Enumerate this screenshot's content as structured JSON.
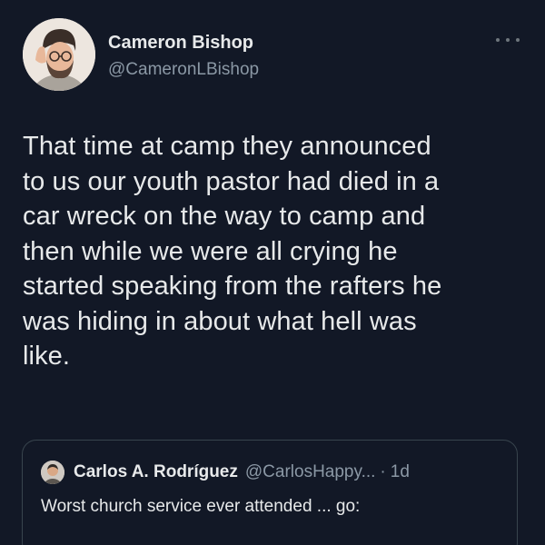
{
  "author": {
    "display_name": "Cameron Bishop",
    "handle": "@CameronLBishop",
    "avatar_icon": "profile-photo"
  },
  "tweet": {
    "text": "That time at camp they announced\nto us our youth pastor had died in a\ncar wreck on the way to camp and\nthen while we were all crying he\nstarted speaking from the rafters he\nwas hiding in about what hell was\nlike."
  },
  "more_icon": "more-horizontal-icon",
  "quoted_tweet": {
    "display_name": "Carlos A. Rodríguez",
    "handle": "@CarlosHappy...",
    "separator": "·",
    "time": "1d",
    "text": "Worst church service ever attended ... go:"
  },
  "colors": {
    "background": "#121826",
    "primary_text": "#e7e9ea",
    "secondary_text": "#8b98a5",
    "border": "#38444d"
  }
}
